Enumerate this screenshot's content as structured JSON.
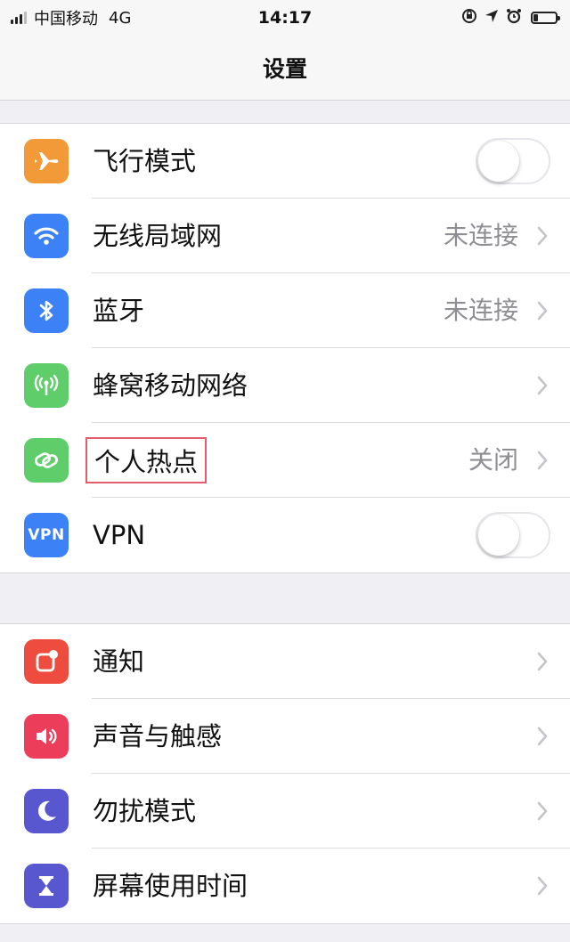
{
  "status_bar": {
    "carrier": "中国移动",
    "network": "4G",
    "time": "14:17",
    "icons": [
      "signal-icon",
      "orientation-lock-icon",
      "location-arrow-icon",
      "alarm-icon",
      "battery-icon"
    ]
  },
  "nav": {
    "title": "设置"
  },
  "colors": {
    "airplane": "#f19a37",
    "wifi": "#3c82f6",
    "bluetooth": "#3c82f6",
    "cellular": "#5fcd6a",
    "hotspot": "#5fcd6a",
    "vpn": "#3c82f6",
    "notifications": "#ee4c3e",
    "sounds": "#ec3e5b",
    "do_not_disturb": "#5957cf",
    "screen_time": "#5957cf",
    "highlight": "#e35d6a"
  },
  "group1": {
    "airplane": {
      "label": "飞行模式",
      "on": false,
      "icon": "airplane-icon"
    },
    "wifi": {
      "label": "无线局域网",
      "value": "未连接",
      "icon": "wifi-icon"
    },
    "bluetooth": {
      "label": "蓝牙",
      "value": "未连接",
      "icon": "bluetooth-icon"
    },
    "cellular": {
      "label": "蜂窝移动网络",
      "icon": "cellular-antenna-icon"
    },
    "hotspot": {
      "label": "个人热点",
      "value": "关闭",
      "icon": "hotspot-link-icon",
      "highlighted": true
    },
    "vpn": {
      "label": "VPN",
      "icon_text": "VPN",
      "on": false
    }
  },
  "group2": {
    "notifications": {
      "label": "通知",
      "icon": "notifications-icon"
    },
    "sounds": {
      "label": "声音与触感",
      "icon": "speaker-icon"
    },
    "do_not_disturb": {
      "label": "勿扰模式",
      "icon": "moon-icon"
    },
    "screen_time": {
      "label": "屏幕使用时间",
      "icon": "hourglass-icon"
    }
  }
}
